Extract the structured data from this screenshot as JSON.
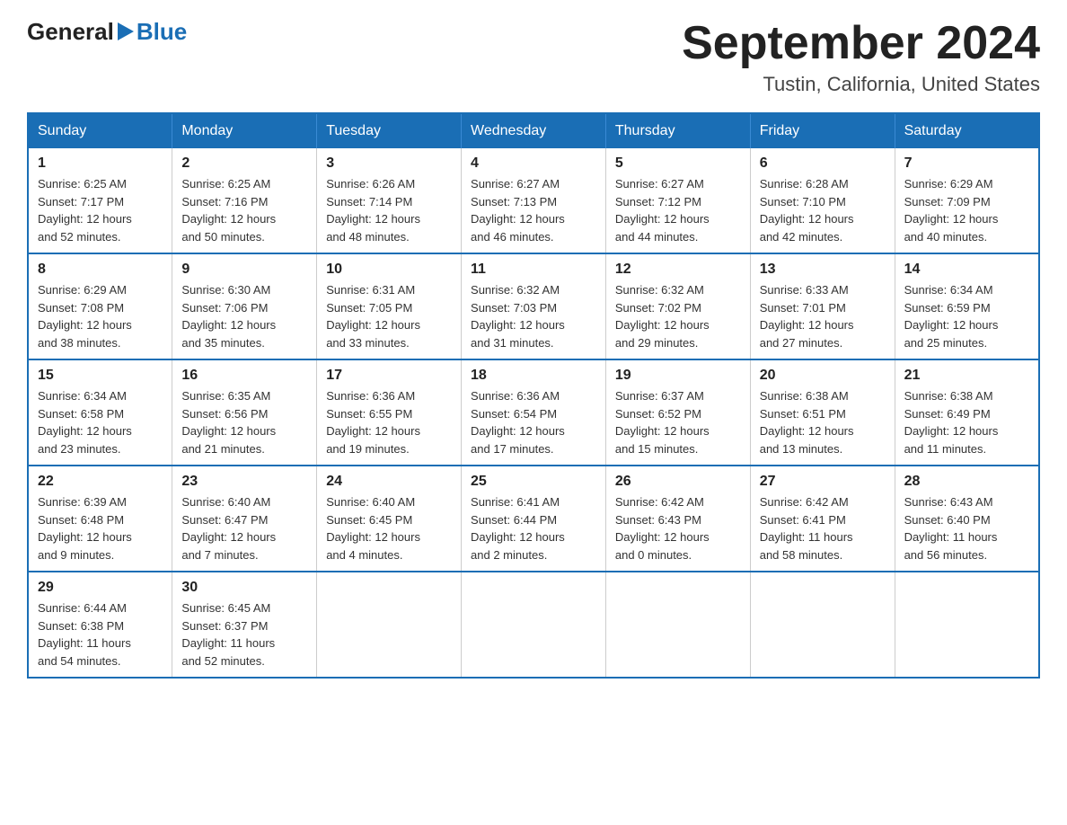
{
  "header": {
    "logo_general": "General",
    "logo_blue": "Blue",
    "title": "September 2024",
    "subtitle": "Tustin, California, United States"
  },
  "days_of_week": [
    "Sunday",
    "Monday",
    "Tuesday",
    "Wednesday",
    "Thursday",
    "Friday",
    "Saturday"
  ],
  "weeks": [
    [
      {
        "day": "1",
        "sunrise": "6:25 AM",
        "sunset": "7:17 PM",
        "daylight": "12 hours and 52 minutes."
      },
      {
        "day": "2",
        "sunrise": "6:25 AM",
        "sunset": "7:16 PM",
        "daylight": "12 hours and 50 minutes."
      },
      {
        "day": "3",
        "sunrise": "6:26 AM",
        "sunset": "7:14 PM",
        "daylight": "12 hours and 48 minutes."
      },
      {
        "day": "4",
        "sunrise": "6:27 AM",
        "sunset": "7:13 PM",
        "daylight": "12 hours and 46 minutes."
      },
      {
        "day": "5",
        "sunrise": "6:27 AM",
        "sunset": "7:12 PM",
        "daylight": "12 hours and 44 minutes."
      },
      {
        "day": "6",
        "sunrise": "6:28 AM",
        "sunset": "7:10 PM",
        "daylight": "12 hours and 42 minutes."
      },
      {
        "day": "7",
        "sunrise": "6:29 AM",
        "sunset": "7:09 PM",
        "daylight": "12 hours and 40 minutes."
      }
    ],
    [
      {
        "day": "8",
        "sunrise": "6:29 AM",
        "sunset": "7:08 PM",
        "daylight": "12 hours and 38 minutes."
      },
      {
        "day": "9",
        "sunrise": "6:30 AM",
        "sunset": "7:06 PM",
        "daylight": "12 hours and 35 minutes."
      },
      {
        "day": "10",
        "sunrise": "6:31 AM",
        "sunset": "7:05 PM",
        "daylight": "12 hours and 33 minutes."
      },
      {
        "day": "11",
        "sunrise": "6:32 AM",
        "sunset": "7:03 PM",
        "daylight": "12 hours and 31 minutes."
      },
      {
        "day": "12",
        "sunrise": "6:32 AM",
        "sunset": "7:02 PM",
        "daylight": "12 hours and 29 minutes."
      },
      {
        "day": "13",
        "sunrise": "6:33 AM",
        "sunset": "7:01 PM",
        "daylight": "12 hours and 27 minutes."
      },
      {
        "day": "14",
        "sunrise": "6:34 AM",
        "sunset": "6:59 PM",
        "daylight": "12 hours and 25 minutes."
      }
    ],
    [
      {
        "day": "15",
        "sunrise": "6:34 AM",
        "sunset": "6:58 PM",
        "daylight": "12 hours and 23 minutes."
      },
      {
        "day": "16",
        "sunrise": "6:35 AM",
        "sunset": "6:56 PM",
        "daylight": "12 hours and 21 minutes."
      },
      {
        "day": "17",
        "sunrise": "6:36 AM",
        "sunset": "6:55 PM",
        "daylight": "12 hours and 19 minutes."
      },
      {
        "day": "18",
        "sunrise": "6:36 AM",
        "sunset": "6:54 PM",
        "daylight": "12 hours and 17 minutes."
      },
      {
        "day": "19",
        "sunrise": "6:37 AM",
        "sunset": "6:52 PM",
        "daylight": "12 hours and 15 minutes."
      },
      {
        "day": "20",
        "sunrise": "6:38 AM",
        "sunset": "6:51 PM",
        "daylight": "12 hours and 13 minutes."
      },
      {
        "day": "21",
        "sunrise": "6:38 AM",
        "sunset": "6:49 PM",
        "daylight": "12 hours and 11 minutes."
      }
    ],
    [
      {
        "day": "22",
        "sunrise": "6:39 AM",
        "sunset": "6:48 PM",
        "daylight": "12 hours and 9 minutes."
      },
      {
        "day": "23",
        "sunrise": "6:40 AM",
        "sunset": "6:47 PM",
        "daylight": "12 hours and 7 minutes."
      },
      {
        "day": "24",
        "sunrise": "6:40 AM",
        "sunset": "6:45 PM",
        "daylight": "12 hours and 4 minutes."
      },
      {
        "day": "25",
        "sunrise": "6:41 AM",
        "sunset": "6:44 PM",
        "daylight": "12 hours and 2 minutes."
      },
      {
        "day": "26",
        "sunrise": "6:42 AM",
        "sunset": "6:43 PM",
        "daylight": "12 hours and 0 minutes."
      },
      {
        "day": "27",
        "sunrise": "6:42 AM",
        "sunset": "6:41 PM",
        "daylight": "11 hours and 58 minutes."
      },
      {
        "day": "28",
        "sunrise": "6:43 AM",
        "sunset": "6:40 PM",
        "daylight": "11 hours and 56 minutes."
      }
    ],
    [
      {
        "day": "29",
        "sunrise": "6:44 AM",
        "sunset": "6:38 PM",
        "daylight": "11 hours and 54 minutes."
      },
      {
        "day": "30",
        "sunrise": "6:45 AM",
        "sunset": "6:37 PM",
        "daylight": "11 hours and 52 minutes."
      },
      null,
      null,
      null,
      null,
      null
    ]
  ],
  "labels": {
    "sunrise": "Sunrise:",
    "sunset": "Sunset:",
    "daylight": "Daylight:"
  }
}
